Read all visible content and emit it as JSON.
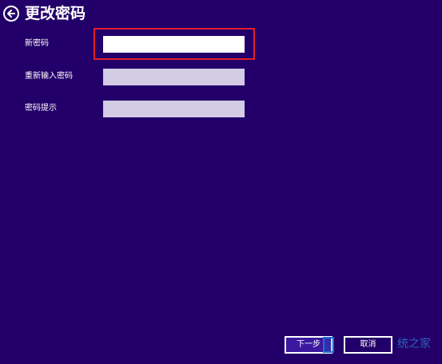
{
  "header": {
    "title": "更改密码",
    "back_icon": "back-arrow-icon"
  },
  "form": {
    "new_password": {
      "label": "新密码",
      "value": ""
    },
    "confirm_password": {
      "label": "重新输入密码",
      "value": ""
    },
    "password_hint": {
      "label": "密码提示",
      "value": ""
    }
  },
  "buttons": {
    "next_label": "下一步",
    "cancel_label": "取消"
  },
  "watermark": {
    "text": "统之家"
  },
  "colors": {
    "background": "#230069",
    "field_inactive": "#d4cbe4",
    "field_active": "#ffffff",
    "highlight": "#e0202a"
  }
}
